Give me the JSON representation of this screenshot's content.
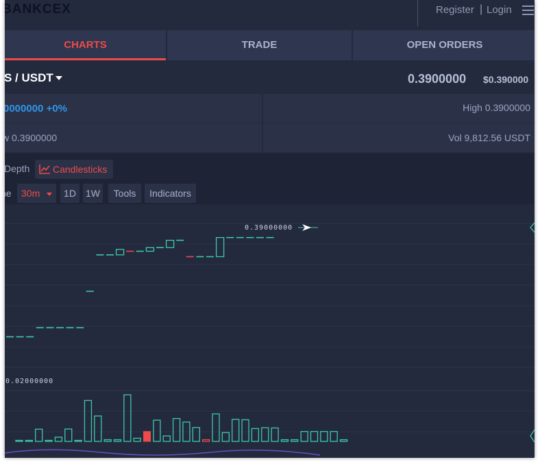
{
  "header": {
    "logo": "BANKCEX",
    "register_label": "Register",
    "separator": "|",
    "login_label": "Login",
    "menu_icon": "hamburger-menu-icon"
  },
  "tabs": [
    {
      "label": "CHARTS",
      "active": true
    },
    {
      "label": "TRADE",
      "active": false
    },
    {
      "label": "OPEN ORDERS",
      "active": false
    }
  ],
  "pair": {
    "name": "S / USDT",
    "last_price": "0.3900000",
    "usd_price": "$0.390000"
  },
  "stats": {
    "change": "0000000 +0%",
    "high": "High 0.3900000",
    "low": "w 0.3900000",
    "volume": "Vol 9,812.56 USDT"
  },
  "chart_toolbar": {
    "depth_label": "Depth",
    "candlesticks_label": "Candlesticks",
    "candlesticks_icon": "line-chart-icon",
    "time_partial": "ne",
    "interval_label": "30m",
    "d1_label": "1D",
    "w1_label": "1W",
    "tools_label": "Tools",
    "indicators_label": "Indicators"
  },
  "colors": {
    "up": "#3ec9a7",
    "down": "#ef4a4a",
    "accent": "#ef4a4a",
    "change": "#2f95e8",
    "background": "#232a3d"
  },
  "chart_data": {
    "type": "candlestick",
    "price_marker_label": "0.39000000",
    "volume_axis_label": "0.02000000",
    "price_candles": [
      {
        "o": 0.27,
        "c": 0.27,
        "dir": "up"
      },
      {
        "o": 0.27,
        "c": 0.27,
        "dir": "up"
      },
      {
        "o": 0.27,
        "c": 0.27,
        "dir": "up"
      },
      {
        "o": 0.28,
        "c": 0.28,
        "dir": "up"
      },
      {
        "o": 0.28,
        "c": 0.28,
        "dir": "up"
      },
      {
        "o": 0.28,
        "c": 0.28,
        "dir": "up"
      },
      {
        "o": 0.28,
        "c": 0.28,
        "dir": "up"
      },
      {
        "o": 0.28,
        "c": 0.28,
        "dir": "up"
      },
      {
        "o": 0.32,
        "c": 0.32,
        "dir": "up"
      },
      {
        "o": 0.36,
        "c": 0.36,
        "dir": "up"
      },
      {
        "o": 0.36,
        "c": 0.36,
        "dir": "up"
      },
      {
        "o": 0.36,
        "c": 0.366,
        "dir": "up"
      },
      {
        "o": 0.364,
        "c": 0.364,
        "dir": "down"
      },
      {
        "o": 0.364,
        "c": 0.364,
        "dir": "up"
      },
      {
        "o": 0.364,
        "c": 0.368,
        "dir": "up"
      },
      {
        "o": 0.368,
        "c": 0.368,
        "dir": "up"
      },
      {
        "o": 0.368,
        "c": 0.376,
        "dir": "up"
      },
      {
        "o": 0.376,
        "c": 0.376,
        "dir": "up"
      },
      {
        "o": 0.358,
        "c": 0.358,
        "dir": "down"
      },
      {
        "o": 0.358,
        "c": 0.358,
        "dir": "up"
      },
      {
        "o": 0.358,
        "c": 0.358,
        "dir": "up"
      },
      {
        "o": 0.358,
        "c": 0.379,
        "dir": "up"
      },
      {
        "o": 0.379,
        "c": 0.379,
        "dir": "up"
      },
      {
        "o": 0.379,
        "c": 0.379,
        "dir": "up"
      },
      {
        "o": 0.379,
        "c": 0.379,
        "dir": "up"
      },
      {
        "o": 0.379,
        "c": 0.379,
        "dir": "up"
      },
      {
        "o": 0.379,
        "c": 0.379,
        "dir": "up"
      }
    ],
    "volume_bars": [
      {
        "v": 3e-05,
        "dir": "up"
      },
      {
        "v": 3e-05,
        "dir": "up"
      },
      {
        "v": 0.0058,
        "dir": "up"
      },
      {
        "v": 3e-05,
        "dir": "up"
      },
      {
        "v": 0.002,
        "dir": "up"
      },
      {
        "v": 0.0059,
        "dir": "up"
      },
      {
        "v": 3e-05,
        "dir": "up"
      },
      {
        "v": 0.0195,
        "dir": "up"
      },
      {
        "v": 0.0121,
        "dir": "up"
      },
      {
        "v": 0.0008,
        "dir": "up"
      },
      {
        "v": 0.0008,
        "dir": "up"
      },
      {
        "v": 0.0222,
        "dir": "up"
      },
      {
        "v": 0.0015,
        "dir": "up"
      },
      {
        "v": 0.0047,
        "dir": "down"
      },
      {
        "v": 0.0101,
        "dir": "up"
      },
      {
        "v": 0.0026,
        "dir": "up"
      },
      {
        "v": 0.0109,
        "dir": "up"
      },
      {
        "v": 0.0092,
        "dir": "up"
      },
      {
        "v": 0.0066,
        "dir": "up"
      },
      {
        "v": 0.0008,
        "dir": "down"
      },
      {
        "v": 0.0131,
        "dir": "up"
      },
      {
        "v": 0.0042,
        "dir": "up"
      },
      {
        "v": 0.0105,
        "dir": "up"
      },
      {
        "v": 0.0103,
        "dir": "up"
      },
      {
        "v": 0.0061,
        "dir": "up"
      },
      {
        "v": 0.0065,
        "dir": "up"
      },
      {
        "v": 0.0064,
        "dir": "up"
      },
      {
        "v": 0.0008,
        "dir": "up"
      },
      {
        "v": 0.0008,
        "dir": "up"
      },
      {
        "v": 0.0047,
        "dir": "up"
      },
      {
        "v": 0.0047,
        "dir": "up"
      },
      {
        "v": 0.0047,
        "dir": "up"
      },
      {
        "v": 0.0047,
        "dir": "up"
      },
      {
        "v": 0.0008,
        "dir": "up"
      }
    ]
  }
}
